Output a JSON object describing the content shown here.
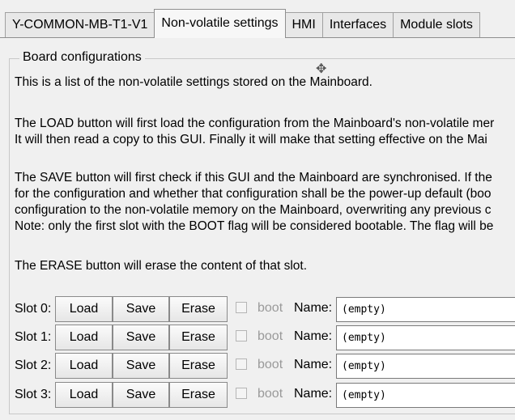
{
  "tabs": [
    {
      "label": "Y-COMMON-MB-T1-V1",
      "active": false
    },
    {
      "label": "Non-volatile settings",
      "active": true
    },
    {
      "label": "HMI",
      "active": false
    },
    {
      "label": "Interfaces",
      "active": false
    },
    {
      "label": "Module slots",
      "active": false
    }
  ],
  "group_title": "Board configurations",
  "paragraphs": {
    "intro": "This is a list of the non-volatile settings stored on the Mainboard.",
    "load_1": "The LOAD button will first load the configuration from the Mainboard's non-volatile mer",
    "load_2": "It will then read a copy to this GUI. Finally it will make that setting effective on the Mai",
    "save_1": "The SAVE button will first check if this GUI and the Mainboard are synchronised. If the",
    "save_2": "for the configuration and whether that configuration shall be the power-up default (boo",
    "save_3": "configuration to the non-volatile memory on the Mainboard, overwriting any previous c",
    "save_4": "Note: only the first slot with the BOOT flag will be considered bootable. The flag will be",
    "erase": "The ERASE button will erase the content of that slot."
  },
  "slots": [
    {
      "label": "Slot 0:",
      "load": "Load",
      "save": "Save",
      "erase": "Erase",
      "boot": "boot",
      "name_label": "Name:",
      "name_value": "(empty)"
    },
    {
      "label": "Slot 1:",
      "load": "Load",
      "save": "Save",
      "erase": "Erase",
      "boot": "boot",
      "name_label": "Name:",
      "name_value": "(empty)"
    },
    {
      "label": "Slot 2:",
      "load": "Load",
      "save": "Save",
      "erase": "Erase",
      "boot": "boot",
      "name_label": "Name:",
      "name_value": "(empty)"
    },
    {
      "label": "Slot 3:",
      "load": "Load",
      "save": "Save",
      "erase": "Erase",
      "boot": "boot",
      "name_label": "Name:",
      "name_value": "(empty)"
    }
  ]
}
